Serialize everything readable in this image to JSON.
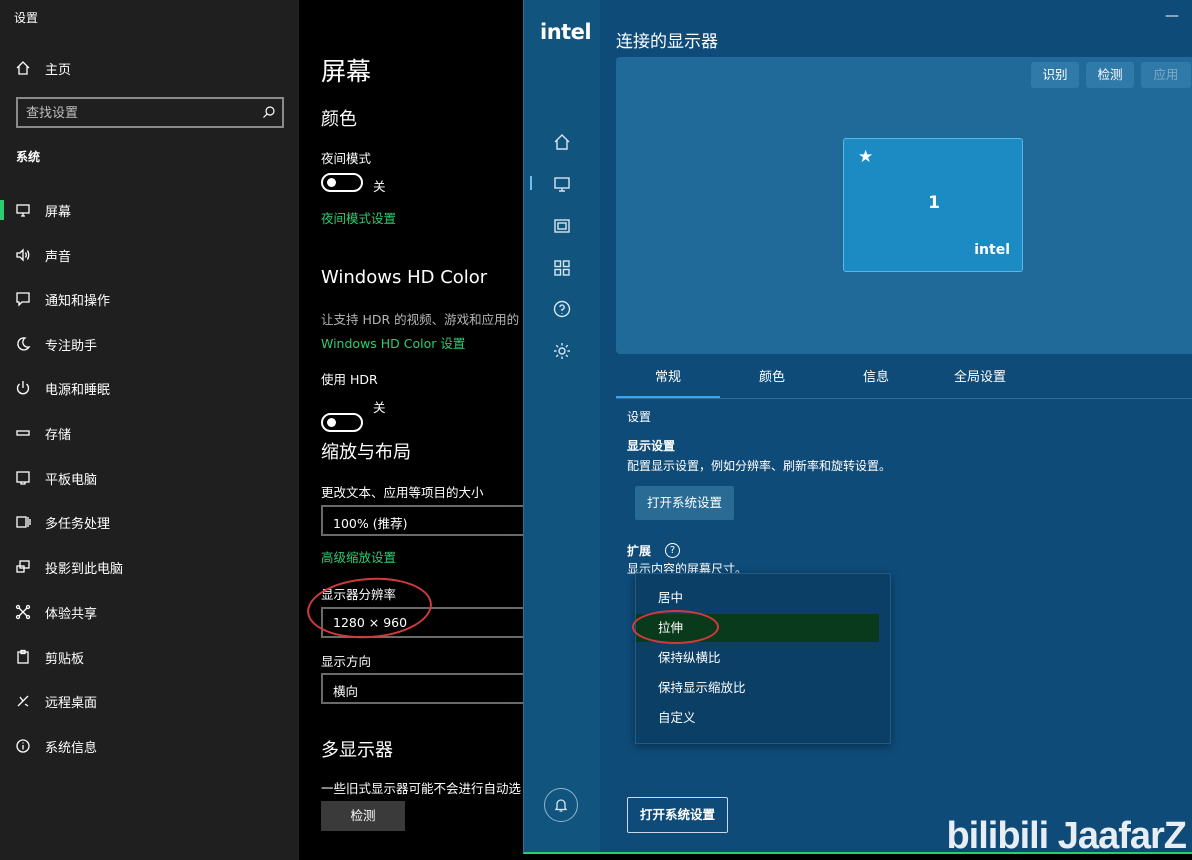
{
  "settings_window": {
    "title": "设置",
    "sidebar": {
      "home_label": "主页",
      "search_placeholder": "查找设置",
      "section_label": "系统",
      "items": [
        {
          "label": "屏幕",
          "icon": "monitor-icon"
        },
        {
          "label": "声音",
          "icon": "speaker-icon"
        },
        {
          "label": "通知和操作",
          "icon": "notification-icon"
        },
        {
          "label": "专注助手",
          "icon": "moon-icon"
        },
        {
          "label": "电源和睡眠",
          "icon": "power-icon"
        },
        {
          "label": "存储",
          "icon": "storage-icon"
        },
        {
          "label": "平板电脑",
          "icon": "tablet-icon"
        },
        {
          "label": "多任务处理",
          "icon": "multitask-icon"
        },
        {
          "label": "投影到此电脑",
          "icon": "project-icon"
        },
        {
          "label": "体验共享",
          "icon": "share-icon"
        },
        {
          "label": "剪贴板",
          "icon": "clipboard-icon"
        },
        {
          "label": "远程桌面",
          "icon": "remote-icon"
        },
        {
          "label": "系统信息",
          "icon": "info-icon"
        }
      ]
    },
    "main": {
      "page_title": "屏幕",
      "color_heading": "颜色",
      "night_mode_label": "夜间模式",
      "night_mode_state": "关",
      "night_mode_link": "夜间模式设置",
      "hdr_heading": "Windows HD Color",
      "hdr_desc": "让支持 HDR 的视频、游戏和应用的",
      "hdr_link": "Windows HD Color 设置",
      "use_hdr_label": "使用 HDR",
      "use_hdr_state": "关",
      "scale_heading": "缩放与布局",
      "text_size_label": "更改文本、应用等项目的大小",
      "text_size_value": "100% (推荐)",
      "advanced_scale_link": "高级缩放设置",
      "resolution_label": "显示器分辨率",
      "resolution_value": "1280 × 960",
      "orientation_label": "显示方向",
      "orientation_value": "横向",
      "multi_display_heading": "多显示器",
      "multi_display_desc": "一些旧式显示器可能不会进行自动选",
      "detect_button": "检测"
    }
  },
  "intel_window": {
    "logo": "intel",
    "title": "连接的显示器",
    "close": "—",
    "canvas_buttons": {
      "identify": "识别",
      "detect": "检测",
      "apply": "应用"
    },
    "monitor": {
      "number": "1",
      "brand": "intel",
      "primary_mark": "★"
    },
    "tabs": [
      "常规",
      "颜色",
      "信息",
      "全局设置"
    ],
    "settings_label": "设置",
    "display_settings_heading": "显示设置",
    "display_settings_desc": "配置显示设置，例如分辨率、刷新率和旋转设置。",
    "open_system_settings": "打开系统设置",
    "extend_heading": "扩展",
    "extend_help": "?",
    "extend_desc": "显示内容的屏幕尺寸。",
    "scale_options": [
      "居中",
      "拉伸",
      "保持纵横比",
      "保持显示缩放比",
      "自定义"
    ],
    "selected_option": "拉伸",
    "bottom_button": "打开系统设置"
  },
  "watermark": "bilibili JaafarZ",
  "colors": {
    "accent_green": "#2ecc71",
    "intel_blue": "#0f4b78",
    "highlight_red": "#d23b3b"
  }
}
